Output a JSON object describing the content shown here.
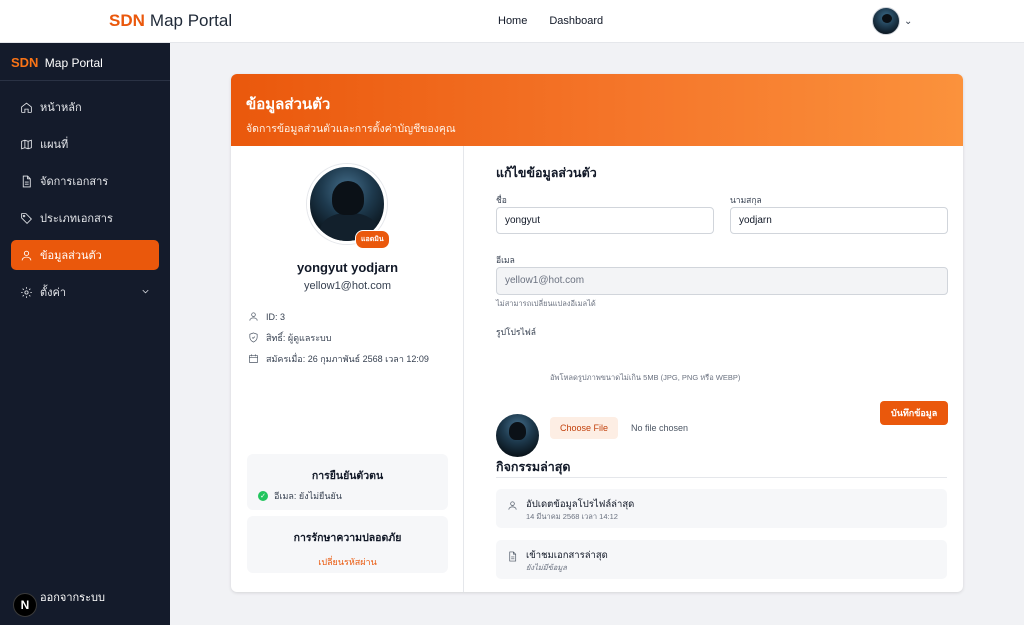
{
  "topbar": {
    "brand_prefix": "SDN",
    "brand_name": "Map Portal",
    "nav": [
      "Home",
      "Dashboard"
    ]
  },
  "sidebar": {
    "brand_prefix": "SDN",
    "brand_name": "Map Portal",
    "items": [
      {
        "label": "หน้าหลัก",
        "icon": "home-icon"
      },
      {
        "label": "แผนที่",
        "icon": "map-icon"
      },
      {
        "label": "จัดการเอกสาร",
        "icon": "document-icon"
      },
      {
        "label": "ประเภทเอกสาร",
        "icon": "tag-icon"
      },
      {
        "label": "ข้อมูลส่วนตัว",
        "icon": "user-icon",
        "active": true
      },
      {
        "label": "ตั้งค่า",
        "icon": "gear-icon"
      }
    ],
    "logout_label": "ออกจากระบบ",
    "next_badge": "N"
  },
  "header": {
    "title": "ข้อมูลส่วนตัว",
    "subtitle": "จัดการข้อมูลส่วนตัวและการตั้งค่าบัญชีของคุณ"
  },
  "profile": {
    "role_badge": "แอดมิน",
    "name": "yongyut yodjarn",
    "email": "yellow1@hot.com",
    "id_text": "ID: 3",
    "role_text": "สิทธิ์: ผู้ดูแลระบบ",
    "joined_text": "สมัครเมื่อ: 26 กุมภาพันธ์ 2568 เวลา 12:09"
  },
  "verification": {
    "title": "การยืนยันตัวตน",
    "email_status": "อีเมล: ยังไม่ยืนยัน"
  },
  "security": {
    "title": "การรักษาความปลอดภัย",
    "change_password": "เปลี่ยนรหัสผ่าน"
  },
  "form": {
    "title": "แก้ไขข้อมูลส่วนตัว",
    "first_name_label": "ชื่อ",
    "first_name_value": "yongyut",
    "last_name_label": "นามสกุล",
    "last_name_value": "yodjarn",
    "email_label": "อีเมล",
    "email_value": "yellow1@hot.com",
    "email_hint": "ไม่สามารถเปลี่ยนแปลงอีเมลได้",
    "photo_label": "รูปโปรไฟล์",
    "choose_file": "Choose File",
    "no_file": "No file chosen",
    "photo_hint": "อัพโหลดรูปภาพขนาดไม่เกิน 5MB (JPG, PNG หรือ WEBP)",
    "save": "บันทึกข้อมูล"
  },
  "activity": {
    "title": "กิจกรรมล่าสุด",
    "items": [
      {
        "title": "อัปเดตข้อมูลโปรไฟล์ล่าสุด",
        "detail": "14 มีนาคม 2568 เวลา 14:12",
        "icon": "user-icon"
      },
      {
        "title": "เข้าชมเอกสารล่าสุด",
        "detail": "ยังไม่มีข้อมูล",
        "icon": "document-icon"
      }
    ]
  },
  "colors": {
    "accent": "#ea580c",
    "sidebar_bg": "#141b2b",
    "success": "#22c55e"
  }
}
